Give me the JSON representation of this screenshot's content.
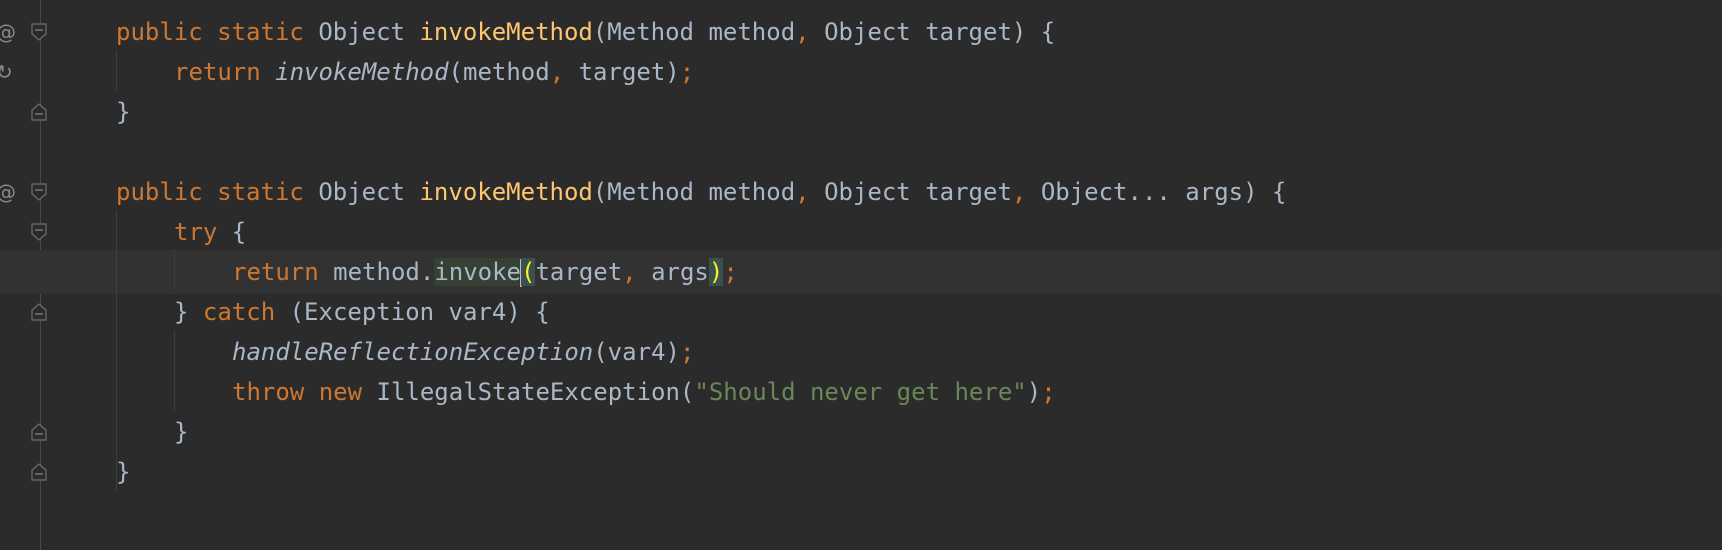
{
  "editor": {
    "lines": [
      {
        "tokens": [
          {
            "cls": "kw",
            "text": "public "
          },
          {
            "cls": "kw",
            "text": "static "
          },
          {
            "cls": "plain",
            "text": "Object "
          },
          {
            "cls": "fn",
            "text": "invokeMethod"
          },
          {
            "cls": "plain",
            "text": "(Method method"
          },
          {
            "cls": "punct",
            "text": ", "
          },
          {
            "cls": "plain",
            "text": "Object target) {"
          }
        ]
      },
      {
        "tokens": [
          {
            "cls": "kw",
            "text": "return "
          },
          {
            "cls": "plain it",
            "text": "invokeMethod"
          },
          {
            "cls": "plain",
            "text": "(method"
          },
          {
            "cls": "punct",
            "text": ", "
          },
          {
            "cls": "plain",
            "text": "target)"
          },
          {
            "cls": "punct",
            "text": ";"
          }
        ]
      },
      {
        "tokens": [
          {
            "cls": "plain",
            "text": "}"
          }
        ]
      },
      {
        "tokens": []
      },
      {
        "tokens": [
          {
            "cls": "kw",
            "text": "public "
          },
          {
            "cls": "kw",
            "text": "static "
          },
          {
            "cls": "plain",
            "text": "Object "
          },
          {
            "cls": "fn",
            "text": "invokeMethod"
          },
          {
            "cls": "plain",
            "text": "(Method method"
          },
          {
            "cls": "punct",
            "text": ", "
          },
          {
            "cls": "plain",
            "text": "Object target"
          },
          {
            "cls": "punct",
            "text": ", "
          },
          {
            "cls": "plain",
            "text": "Object... args) {"
          }
        ]
      },
      {
        "tokens": [
          {
            "cls": "kw",
            "text": "try "
          },
          {
            "cls": "plain",
            "text": "{"
          }
        ]
      },
      {
        "tokens": [
          {
            "cls": "kw",
            "text": "return "
          },
          {
            "cls": "plain",
            "text": "method."
          },
          {
            "cls": "plain hl-usage",
            "text": "invoke"
          },
          {
            "cls": "caret",
            "text": ""
          },
          {
            "cls": "hl-brace",
            "text": "("
          },
          {
            "cls": "plain",
            "text": "target"
          },
          {
            "cls": "punct",
            "text": ", "
          },
          {
            "cls": "plain",
            "text": "args"
          },
          {
            "cls": "hl-brace",
            "text": ")"
          },
          {
            "cls": "punct",
            "text": ";"
          }
        ]
      },
      {
        "tokens": [
          {
            "cls": "plain",
            "text": "} "
          },
          {
            "cls": "kw",
            "text": "catch "
          },
          {
            "cls": "plain",
            "text": "(Exception var4) {"
          }
        ]
      },
      {
        "tokens": [
          {
            "cls": "plain it",
            "text": "handleReflectionException"
          },
          {
            "cls": "plain",
            "text": "(var4)"
          },
          {
            "cls": "punct",
            "text": ";"
          }
        ]
      },
      {
        "tokens": [
          {
            "cls": "kw",
            "text": "throw "
          },
          {
            "cls": "kw",
            "text": "new "
          },
          {
            "cls": "plain",
            "text": "IllegalStateException("
          },
          {
            "cls": "str",
            "text": "\"Should never get here\""
          },
          {
            "cls": "plain",
            "text": ")"
          },
          {
            "cls": "punct",
            "text": ";"
          }
        ]
      },
      {
        "tokens": [
          {
            "cls": "plain",
            "text": "}"
          }
        ]
      },
      {
        "tokens": [
          {
            "cls": "plain",
            "text": "}"
          }
        ]
      }
    ],
    "gutter_icons": [
      {
        "line": 0,
        "icon": "override-method-icon",
        "glyph": "@"
      },
      {
        "line": 1,
        "icon": "recursive-call-icon",
        "glyph": "↻"
      },
      {
        "line": 4,
        "icon": "override-method-icon",
        "glyph": "@"
      }
    ],
    "fold_markers": [
      {
        "line": 0,
        "type": "start"
      },
      {
        "line": 2,
        "type": "end"
      },
      {
        "line": 4,
        "type": "start"
      },
      {
        "line": 5,
        "type": "start"
      },
      {
        "line": 7,
        "type": "end"
      },
      {
        "line": 10,
        "type": "end"
      },
      {
        "line": 11,
        "type": "end"
      }
    ],
    "current_line": 6,
    "colors": {
      "background": "#2b2b2b",
      "keyword": "#cc7832",
      "function_decl": "#ffc66d",
      "string": "#6a8759",
      "plain": "#a9b7c6",
      "current_line": "#323232"
    }
  }
}
